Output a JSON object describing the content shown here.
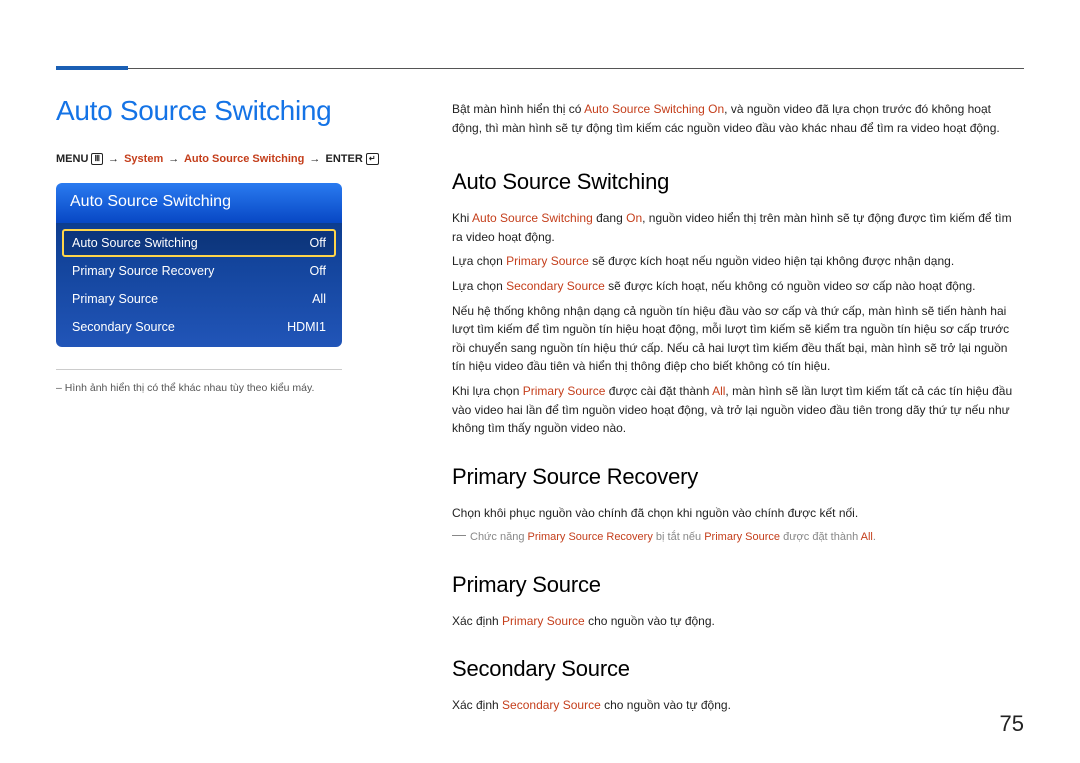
{
  "page_number": "75",
  "heading_main": "Auto Source Switching",
  "breadcrumb": {
    "menu": "MENU",
    "system": "System",
    "ass": "Auto Source Switching",
    "enter": "ENTER"
  },
  "osd": {
    "title": "Auto Source Switching",
    "rows": [
      {
        "label": "Auto Source Switching",
        "value": "Off",
        "highlight": true
      },
      {
        "label": "Primary Source Recovery",
        "value": "Off",
        "highlight": false
      },
      {
        "label": "Primary Source",
        "value": "All",
        "highlight": false
      },
      {
        "label": "Secondary Source",
        "value": "HDMI1",
        "highlight": false
      }
    ]
  },
  "left_footnote": "Hình ảnh hiển thị có thể khác nhau tùy theo kiểu máy.",
  "intro": {
    "pre": "Bật màn hình hiển thị có ",
    "kw1": "Auto Source Switching On",
    "post": ", và nguồn video đã lựa chọn trước đó không hoạt động, thì màn hình sẽ tự động tìm kiếm các nguồn video đầu vào khác nhau để tìm ra video hoạt động."
  },
  "sections": {
    "ass": {
      "title": "Auto Source Switching",
      "p1": {
        "pre": "Khi ",
        "kw1": "Auto Source Switching",
        "mid": " đang ",
        "kw2": "On",
        "post": ", nguồn video hiển thị trên màn hình sẽ tự động được tìm kiếm để tìm ra video hoạt động."
      },
      "p2": {
        "pre": "Lựa chọn ",
        "kw": "Primary Source",
        "post": " sẽ được kích hoạt nếu nguồn video hiện tại không được nhận dạng."
      },
      "p3": {
        "pre": "Lựa chọn ",
        "kw": "Secondary Source",
        "post": " sẽ được kích hoạt, nếu không có nguồn video sơ cấp nào hoạt động."
      },
      "p4": "Nếu hệ thống không nhận dạng cả nguồn tín hiệu đầu vào sơ cấp và thứ cấp, màn hình sẽ tiến hành hai lượt tìm kiếm để tìm nguồn tín hiệu hoạt động, mỗi lượt tìm kiếm sẽ kiểm tra nguồn tín hiệu sơ cấp trước rồi chuyển sang nguồn tín hiệu thứ cấp. Nếu cả hai lượt tìm kiếm đều thất bại, màn hình sẽ trở lại nguồn tín hiệu video đầu tiên và hiển thị thông điệp cho biết không có tín hiệu.",
      "p5": {
        "pre": "Khi lựa chọn ",
        "kw1": "Primary Source",
        "mid": " được cài đặt thành ",
        "kw2": "All",
        "post": ", màn hình sẽ lần lượt tìm kiếm tất cả các tín hiệu đầu vào video hai lần để tìm nguồn video hoạt động, và trở lại nguồn video đầu tiên trong dãy thứ tự nếu như không tìm thấy nguồn video nào."
      }
    },
    "psr": {
      "title": "Primary Source Recovery",
      "p1": "Chọn khôi phục nguồn vào chính đã chọn khi nguồn vào chính được kết nối.",
      "note": {
        "pre": "Chức năng ",
        "kw1": "Primary Source Recovery",
        "mid": " bị tắt nếu ",
        "kw2": "Primary Source",
        "post": " được đặt thành ",
        "kw3": "All",
        "end": "."
      }
    },
    "ps": {
      "title": "Primary Source",
      "p1": {
        "pre": "Xác định ",
        "kw": "Primary Source",
        "post": " cho nguồn vào tự động."
      }
    },
    "ss": {
      "title": "Secondary Source",
      "p1": {
        "pre": "Xác định ",
        "kw": "Secondary Source",
        "post": " cho nguồn vào tự động."
      }
    }
  }
}
